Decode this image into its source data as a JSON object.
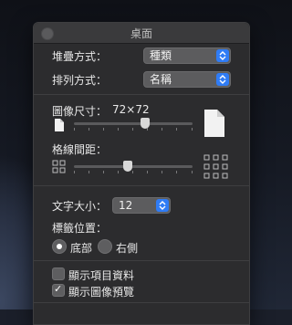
{
  "window": {
    "title": "桌面"
  },
  "sort_section": {
    "stack_by_label": "堆疊方式：",
    "stack_by_value": "種類",
    "sort_by_label": "排列方式：",
    "sort_by_value": "名稱"
  },
  "icon_section": {
    "icon_size_label": "圖像尺寸：",
    "icon_size_value": "72×72",
    "icon_size_level": 0.6,
    "grid_spacing_label": "格線間距：",
    "grid_spacing_level": 0.45
  },
  "text_section": {
    "text_size_label": "文字大小：",
    "text_size_value": "12",
    "label_position_label": "標籤位置：",
    "label_bottom": "底部",
    "label_right": "右側",
    "selected_position": "底部"
  },
  "options": {
    "show_item_info": "顯示項目資料",
    "show_item_info_checked": false,
    "show_icon_preview": "顯示圖像預覽",
    "show_icon_preview_checked": true
  },
  "colors": {
    "accent": "#2f7cf6",
    "panel": "#2c2c2e"
  },
  "icons": {
    "small_icon": "document-small-icon",
    "large_icon": "document-large-icon",
    "grid_small": "grid-tight-icon",
    "grid_large": "grid-wide-icon",
    "stepper": "chevron-up-down-icon"
  }
}
